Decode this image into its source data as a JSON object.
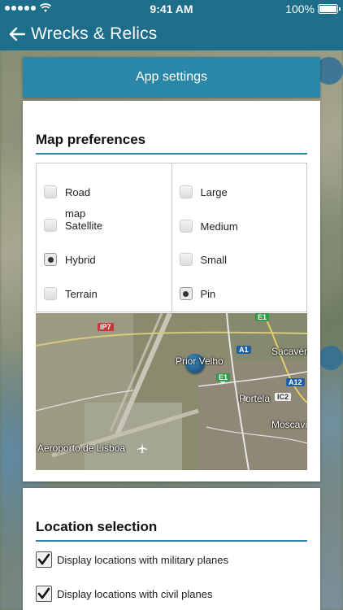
{
  "status_bar": {
    "time": "9:41 AM",
    "battery": "100%",
    "signal_icon": "signal-dots-icon",
    "wifi_icon": "wifi-icon",
    "battery_icon": "battery-icon"
  },
  "app_bar": {
    "back_icon": "arrow-left-icon",
    "title": "Wrecks & Relics"
  },
  "settings": {
    "header": "App settings"
  },
  "map_preferences": {
    "title": "Map preferences",
    "map_types": [
      {
        "label": "Road",
        "selected": false
      },
      {
        "label": "map\nSatellite",
        "selected": false
      },
      {
        "label": "Hybrid",
        "selected": true
      },
      {
        "label": "Terrain",
        "selected": false
      }
    ],
    "marker_sizes": [
      {
        "label": "Large",
        "selected": false
      },
      {
        "label": "Medium",
        "selected": false
      },
      {
        "label": "Small",
        "selected": false
      },
      {
        "label": "Pin",
        "selected": true
      }
    ],
    "preview": {
      "labels": [
        "Prior Velho",
        "Portela",
        "Sacavém",
        "Moscavide",
        "Aeroporto de Lisboa"
      ],
      "road_badges": [
        "IP7",
        "A1",
        "E1",
        "A12",
        "IC2",
        "E1"
      ],
      "airport_icon": "airplane-icon"
    }
  },
  "location_selection": {
    "title": "Location selection",
    "items": [
      {
        "label": "Display locations with military planes",
        "checked": true
      },
      {
        "label": "Display locations with civil planes",
        "checked": true
      }
    ]
  },
  "colors": {
    "brand": "#1c6e8a",
    "header": "#2a87a8"
  }
}
